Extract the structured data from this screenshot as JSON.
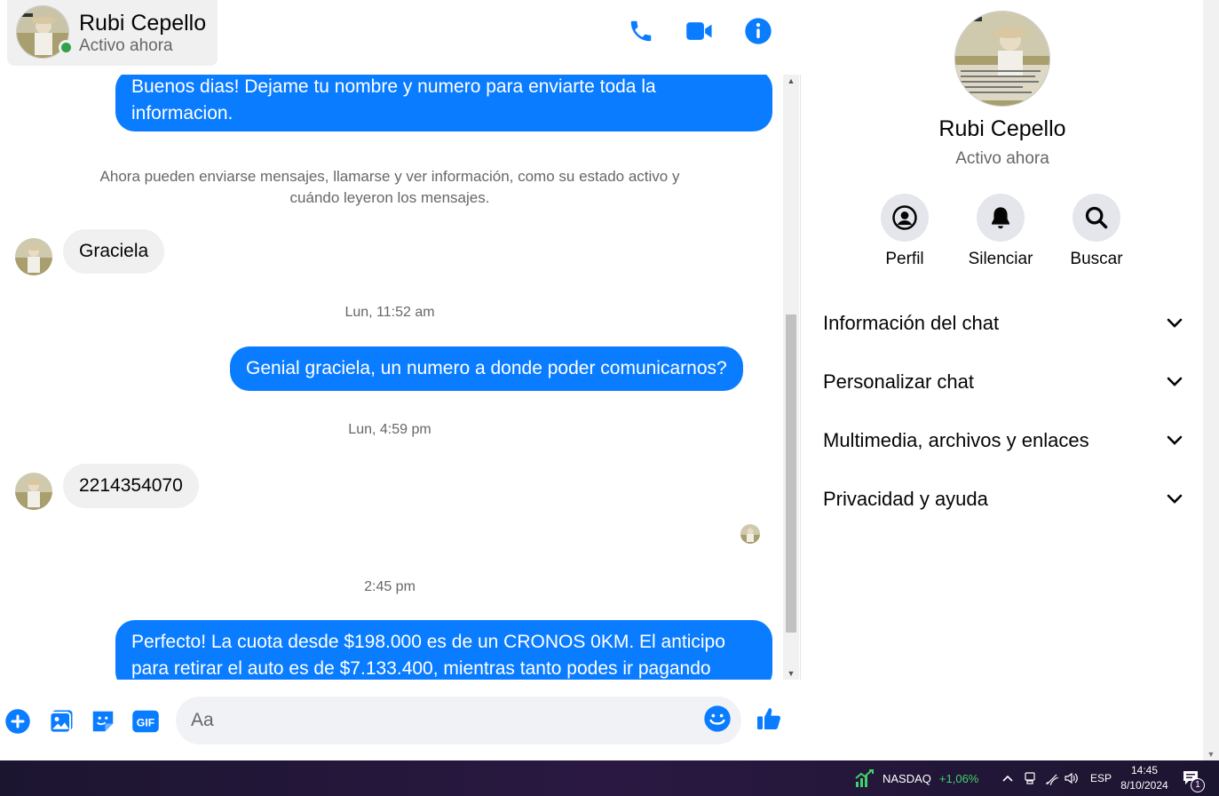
{
  "contact": {
    "name": "Rubi Cepello",
    "status": "Activo ahora"
  },
  "header": {
    "call_icon": "phone-icon",
    "video_icon": "video-camera-icon",
    "info_icon": "info-icon"
  },
  "messages": {
    "out_1": "Buenos dias! Dejame tu nombre y  numero para enviarte toda la informacion.",
    "system_notice": "Ahora pueden enviarse mensajes, llamarse y ver información, como su estado activo y cuándo leyeron los mensajes.",
    "in_1": "Graciela",
    "time_1": "Lun, 11:52 am",
    "out_2": "Genial graciela, un numero a donde poder comunicarnos?",
    "time_2": "Lun, 4:59 pm",
    "in_2": "2214354070",
    "time_3": "2:45 pm",
    "out_3": "Perfecto! La cuota desde $198.000 es de un CRONOS 0KM. El anticipo para retirar el auto es de $7.133.400, mientras tanto podes ir pagando"
  },
  "composer": {
    "placeholder": "Aa"
  },
  "info_panel": {
    "name": "Rubi Cepello",
    "status": "Activo ahora",
    "actions": [
      {
        "label": "Perfil",
        "icon": "profile-icon"
      },
      {
        "label": "Silenciar",
        "icon": "bell-icon"
      },
      {
        "label": "Buscar",
        "icon": "search-icon"
      }
    ],
    "sections": [
      {
        "label": "Información del chat"
      },
      {
        "label": "Personalizar chat"
      },
      {
        "label": "Multimedia, archivos y enlaces"
      },
      {
        "label": "Privacidad y ayuda"
      }
    ]
  },
  "taskbar": {
    "ticker_name": "NASDAQ",
    "ticker_change": "+1,06%",
    "language": "ESP",
    "time": "14:45",
    "date": "8/10/2024",
    "notification_count": "1"
  },
  "colors": {
    "accent": "#0a7cff",
    "bubble_in": "#f0f0f0",
    "online": "#31a24c",
    "ticker_up": "#3fd16b"
  }
}
